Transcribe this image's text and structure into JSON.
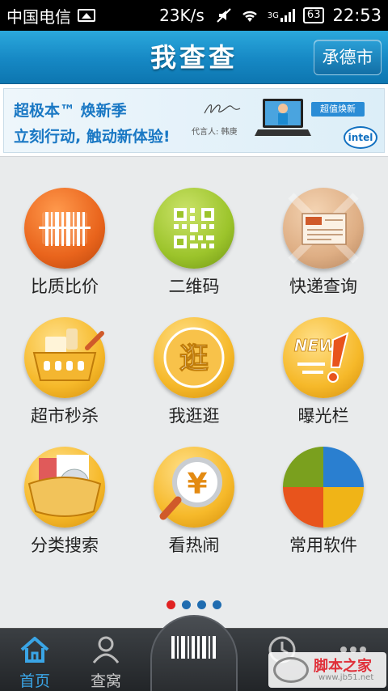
{
  "status_bar": {
    "carrier": "中国电信",
    "speed": "23K/s",
    "network": "3G",
    "battery": "63",
    "time": "22:53"
  },
  "header": {
    "title": "我查查",
    "city_button": "承德市"
  },
  "banner": {
    "line1": "超极本™ 焕新季",
    "line2": "立刻行动, 触动新体验!",
    "endorser": "代言人: 韩庚",
    "promo_tag": "超值焕新",
    "logo_text": "intel"
  },
  "grid": [
    {
      "label": "比质比价",
      "icon": "barcode-icon"
    },
    {
      "label": "二维码",
      "icon": "qrcode-icon"
    },
    {
      "label": "快递查询",
      "icon": "package-icon"
    },
    {
      "label": "超市秒杀",
      "icon": "shopping-basket-icon"
    },
    {
      "label": "我逛逛",
      "icon": "browse-icon",
      "glyph": "逛"
    },
    {
      "label": "曝光栏",
      "icon": "new-exclamation-icon",
      "glyph": "NEW"
    },
    {
      "label": "分类搜索",
      "icon": "folder-category-icon"
    },
    {
      "label": "看热闹",
      "icon": "magnifier-yuan-icon",
      "glyph": "¥"
    },
    {
      "label": "常用软件",
      "icon": "app-quadrant-icon"
    }
  ],
  "pager": {
    "count": 4,
    "active": 0
  },
  "tabbar": {
    "tabs": [
      {
        "label": "首页",
        "icon": "home-icon",
        "active": true
      },
      {
        "label": "查窝",
        "icon": "user-icon",
        "active": false
      },
      {
        "label": "",
        "icon": "history-icon",
        "active": false
      },
      {
        "label": "",
        "icon": "more-icon",
        "active": false
      }
    ],
    "center_icon": "barcode-scan-icon"
  },
  "watermark": {
    "big": "脚本之家",
    "small": "www.jb51.net"
  },
  "colors": {
    "header_blue": "#1688c4",
    "active_tab": "#3aa5e6",
    "pager_active": "#e02222",
    "pager_inactive": "#1f6cb0"
  }
}
